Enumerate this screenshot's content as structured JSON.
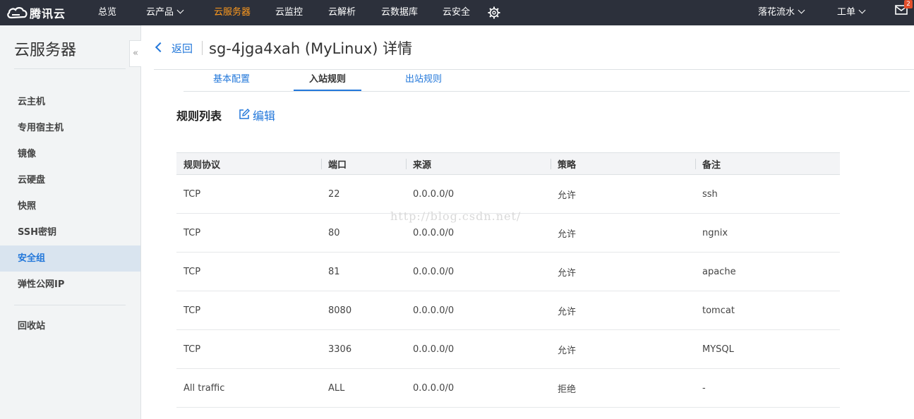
{
  "topbar": {
    "brand": "腾讯云",
    "nav": [
      {
        "label": "总览",
        "dropdown": false,
        "active": false
      },
      {
        "label": "云产品",
        "dropdown": true,
        "active": false
      },
      {
        "label": "云服务器",
        "dropdown": false,
        "active": true
      },
      {
        "label": "云监控",
        "dropdown": false,
        "active": false
      },
      {
        "label": "云解析",
        "dropdown": false,
        "active": false
      },
      {
        "label": "云数据库",
        "dropdown": false,
        "active": false
      },
      {
        "label": "云安全",
        "dropdown": false,
        "active": false
      }
    ],
    "user": "落花流水",
    "ticket": "工单",
    "mail_badge": "2",
    "colors": {
      "bg": "#2c303b",
      "active": "#ff9a1d",
      "badge": "#e24f2c"
    }
  },
  "sidebar": {
    "title": "云服务器",
    "collapse_glyph": "«",
    "items": [
      {
        "label": "云主机"
      },
      {
        "label": "专用宿主机"
      },
      {
        "label": "镜像"
      },
      {
        "label": "云硬盘"
      },
      {
        "label": "快照"
      },
      {
        "label": "SSH密钥"
      },
      {
        "label": "安全组",
        "active": true
      },
      {
        "label": "弹性公网IP"
      },
      {
        "label": "回收站"
      }
    ]
  },
  "header": {
    "back_label": "返回",
    "title": "sg-4jga4xah (MyLinux) 详情"
  },
  "tabs": [
    {
      "label": "基本配置"
    },
    {
      "label": "入站规则",
      "active": true
    },
    {
      "label": "出站规则"
    }
  ],
  "section": {
    "title": "规则列表",
    "edit_label": "编辑"
  },
  "table": {
    "columns": [
      "规则协议",
      "端口",
      "来源",
      "策略",
      "备注"
    ],
    "rows": [
      [
        "TCP",
        "22",
        "0.0.0.0/0",
        "允许",
        "ssh"
      ],
      [
        "TCP",
        "80",
        "0.0.0.0/0",
        "允许",
        "ngnix"
      ],
      [
        "TCP",
        "81",
        "0.0.0.0/0",
        "允许",
        "apache"
      ],
      [
        "TCP",
        "8080",
        "0.0.0.0/0",
        "允许",
        "tomcat"
      ],
      [
        "TCP",
        "3306",
        "0.0.0.0/0",
        "允许",
        "MYSQL"
      ],
      [
        "All traffic",
        "ALL",
        "0.0.0.0/0",
        "拒绝",
        "-"
      ]
    ]
  },
  "watermark": "http://blog.csdn.net/",
  "accent_color": "#2277da"
}
